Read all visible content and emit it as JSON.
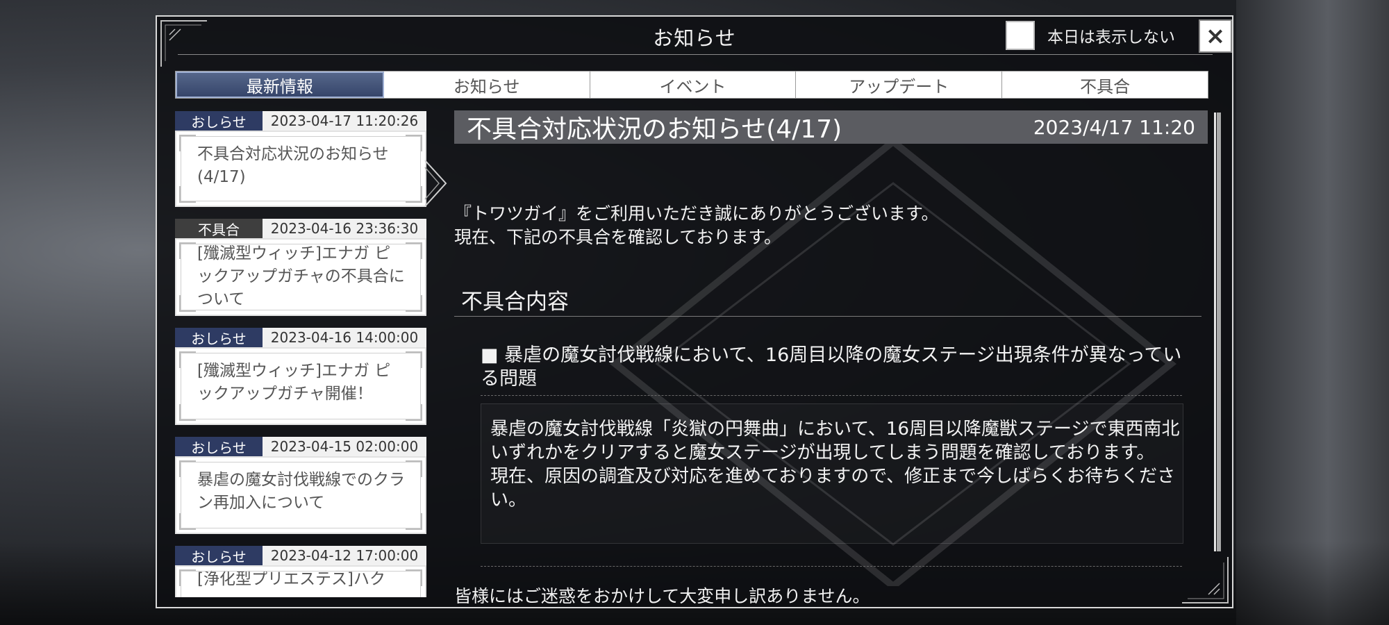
{
  "dialog": {
    "title": "お知らせ",
    "dont_show_label": "本日は表示しない",
    "close_label": "×"
  },
  "tabs": [
    {
      "label": "最新情報",
      "active": true
    },
    {
      "label": "お知らせ",
      "active": false
    },
    {
      "label": "イベント",
      "active": false
    },
    {
      "label": "アップデート",
      "active": false
    },
    {
      "label": "不具合",
      "active": false
    }
  ],
  "list": [
    {
      "tag": "おしらせ",
      "type": "notice",
      "date": "2023-04-17 11:20:26",
      "title": "不具合対応状況のお知らせ(4/17)"
    },
    {
      "tag": "不具合",
      "type": "bug",
      "date": "2023-04-16 23:36:30",
      "title": "[殲滅型ウィッチ]エナガ ピックアップガチャの不具合について"
    },
    {
      "tag": "おしらせ",
      "type": "notice",
      "date": "2023-04-16 14:00:00",
      "title": "[殲滅型ウィッチ]エナガ ピックアップガチャ開催！"
    },
    {
      "tag": "おしらせ",
      "type": "notice",
      "date": "2023-04-15 02:00:00",
      "title": "暴虐の魔女討伐戦線でのクラン再加入について"
    },
    {
      "tag": "おしらせ",
      "type": "notice",
      "date": "2023-04-12 17:00:00",
      "title": "[浄化型プリエステス]ハク"
    }
  ],
  "article": {
    "title": "不具合対応状況のお知らせ(4/17)",
    "date": "2023/4/17 11:20",
    "intro_line1": "『トワツガイ』をご利用いただき誠にありがとうございます。",
    "intro_line2": "現在、下記の不具合を確認しております。",
    "section_heading": "不具合内容",
    "issue_title": "■ 暴虐の魔女討伐戦線において、16周目以降の魔女ステージ出現条件が異なっている問題",
    "issue_detail_1": "暴虐の魔女討伐戦線「炎獄の円舞曲」において、16周目以降魔獣ステージで東西南北いずれかをクリアすると魔女ステージが出現してしまう問題を確認しております。",
    "issue_detail_2": "現在、原因の調査及び対応を進めておりますので、修正まで今しばらくお待ちください。",
    "apology": "皆様にはご迷惑をおかけして大変申し訳ありません。"
  },
  "colors": {
    "active_tab": "#3b4a70",
    "notice_tag": "#2e3b63",
    "bug_tag": "#3e3e3e",
    "article_header": "#5b5c61"
  }
}
